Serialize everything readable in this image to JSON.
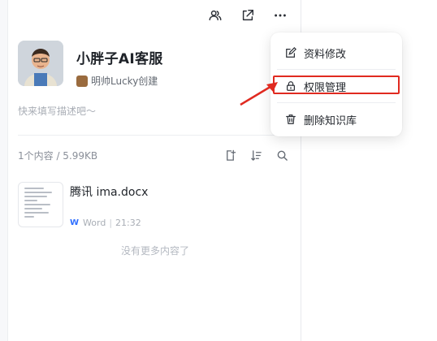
{
  "top_icons": [
    "members-icon",
    "share-icon",
    "more-icon"
  ],
  "kb": {
    "title": "小胖子AI客服",
    "creator": "明帅Lucky创建",
    "description_placeholder": "快来填写描述吧～"
  },
  "toolbar": {
    "content_count": "1个内容 / 5.99KB",
    "icons": [
      "add-file-icon",
      "sort-icon",
      "search-icon"
    ]
  },
  "files": [
    {
      "name": "腾讯 ima.docx",
      "type": "Word",
      "time": "21:32",
      "type_badge": "W"
    }
  ],
  "no_more_text": "没有更多内容了",
  "menu": {
    "items": [
      {
        "label": "资料修改",
        "icon": "edit-icon"
      },
      {
        "label": "权限管理",
        "icon": "lock-icon",
        "highlighted": true
      },
      {
        "label": "删除知识库",
        "icon": "trash-icon"
      }
    ]
  },
  "colors": {
    "accent_word": "#2f6fff",
    "highlight_red": "#e02a20",
    "muted_text": "#a8adb5"
  }
}
